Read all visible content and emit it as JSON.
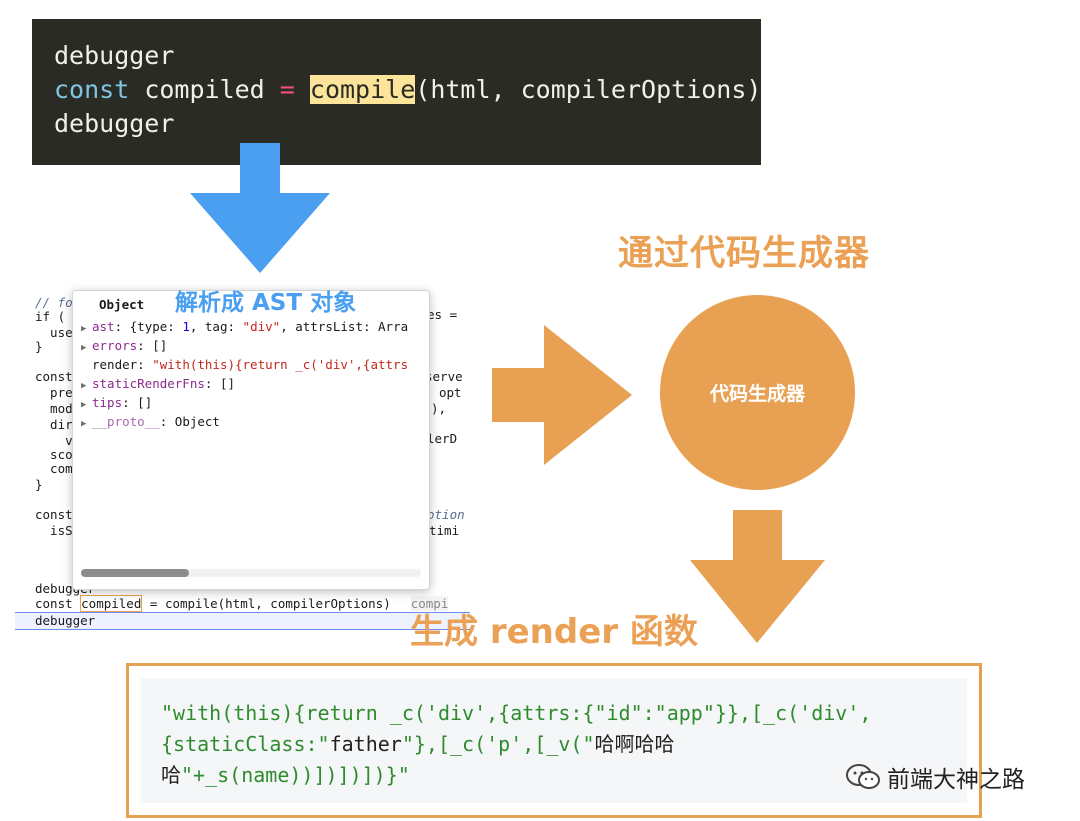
{
  "code_panel": {
    "line1": "debugger",
    "line2_kw": "const",
    "line2_var": " compiled ",
    "line2_op": "=",
    "line2_fn": "compile",
    "line2_args": "(html, compilerOptions)",
    "line3": "debugger"
  },
  "debugger_view": {
    "bg_lines": [
      {
        "text": "// fo",
        "cls": "comment"
      },
      {
        "text": "if (",
        "cls": ""
      },
      {
        "text": "  use",
        "cls": ""
      },
      {
        "text": "}",
        "cls": ""
      },
      {
        "text": "const",
        "cls": ""
      },
      {
        "text": "  pre",
        "cls": ""
      },
      {
        "text": "  mod",
        "cls": ""
      },
      {
        "text": "  dir",
        "cls": ""
      },
      {
        "text": "    v",
        "cls": ""
      },
      {
        "text": "  sco",
        "cls": ""
      },
      {
        "text": "  com",
        "cls": ""
      },
      {
        "text": "}",
        "cls": ""
      },
      {
        "text": "const",
        "cls": ""
      },
      {
        "text": "  isS",
        "cls": ""
      }
    ],
    "right_fragments": [
      "es =",
      "serve",
      "opt",
      "),",
      "lerD",
      "otion",
      "timi"
    ],
    "bottom_debugger1": "debugger",
    "bottom_const": "const ",
    "bottom_compiled": "compiled",
    "bottom_rest": " = compile(html, compilerOptions)",
    "bottom_hint": "compi",
    "bottom_debugger2": "debugger"
  },
  "object_popup": {
    "title": "Object",
    "rows": [
      {
        "key": "ast",
        "value": "{type: 1, tag: \"div\", attrsList: Arra",
        "expandable": true
      },
      {
        "key": "errors",
        "value": "[]",
        "expandable": true
      },
      {
        "key": "render",
        "value": "\"with(this){return _c('div',{attrs",
        "expandable": false
      },
      {
        "key": "staticRenderFns",
        "value": "[]",
        "expandable": true
      },
      {
        "key": "tips",
        "value": "[]",
        "expandable": true
      },
      {
        "key": "__proto__",
        "value": "Object",
        "expandable": true
      }
    ]
  },
  "ast_label": "解析成 AST 对象",
  "codegen_title": "通过代码生成器",
  "codegen_circle_label": "代码生成器",
  "render_title": "生成 render 函数",
  "render_code": {
    "line1": "\"with(this){return _c('div',{attrs:{\"id\":\"app\"}},[_c('div',",
    "line2_a": "{staticClass:\"",
    "line2_b": "father",
    "line2_c": "\"},[_c('p',[_v(\"",
    "line2_d": "哈啊哈哈",
    "line3_a": "哈",
    "line3_b": "\"+_s(name))])])])}\""
  },
  "watermark": {
    "icon": "wechat-icon",
    "text": "前端大神之路"
  },
  "colors": {
    "orange": "#e8a153",
    "blue": "#4a9ff0",
    "panel_bg": "#2b2b26",
    "code_green": "#2e8b2e"
  }
}
